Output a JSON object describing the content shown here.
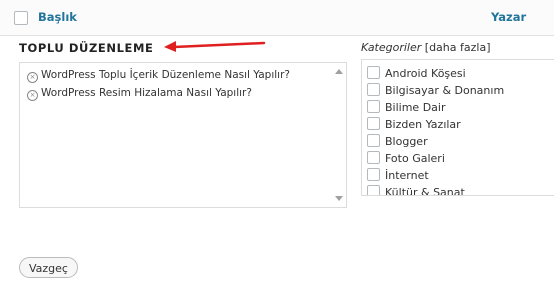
{
  "header": {
    "title_col": "Başlık",
    "author_col": "Yazar"
  },
  "bulk_edit": {
    "title": "TOPLU DÜZENLEME",
    "posts": [
      "WordPress Toplu İçerik Düzenleme Nasıl Yapılır?",
      "WordPress Resim Hizalama Nasıl Yapılır?"
    ]
  },
  "categories": {
    "label": "Kategoriler",
    "more_link": "[daha fazla]",
    "items": [
      "Android Köşesi",
      "Bilgisayar & Donanım",
      "Bilime Dair",
      "Bizden Yazılar",
      "Blogger",
      "Foto Galeri",
      "İnternet",
      "Kültür & Sanat"
    ]
  },
  "actions": {
    "cancel": "Vazgeç"
  },
  "colors": {
    "link": "#21759b",
    "arrow": "#e02020"
  }
}
